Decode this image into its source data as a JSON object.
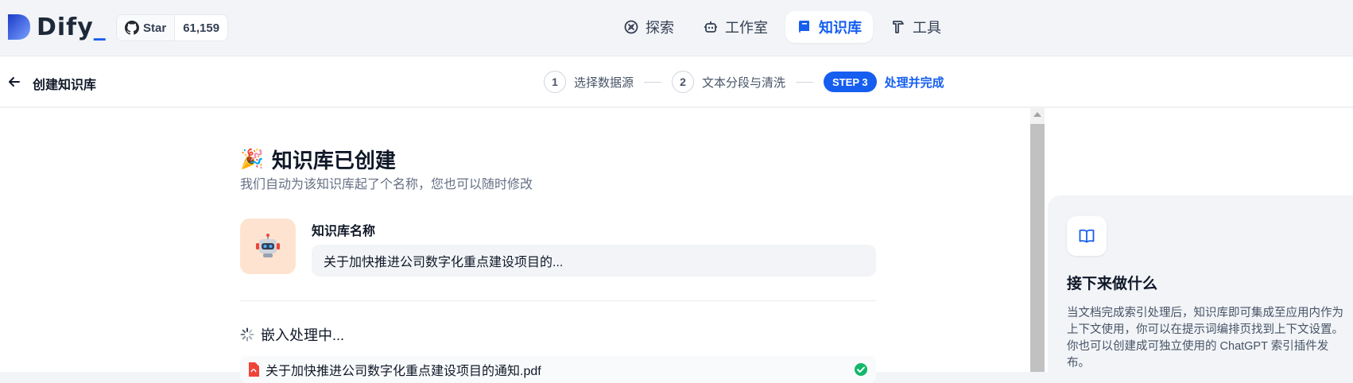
{
  "app": {
    "logo_text": "Dify",
    "github_star_label": "Star",
    "github_star_count": "61,159"
  },
  "nav": {
    "items": [
      {
        "label": "探索",
        "icon": "compass-icon"
      },
      {
        "label": "工作室",
        "icon": "robot-icon"
      },
      {
        "label": "知识库",
        "icon": "book-icon",
        "active": true
      },
      {
        "label": "工具",
        "icon": "hammer-icon"
      }
    ]
  },
  "stepbar": {
    "breadcrumb": "创建知识库",
    "steps": [
      {
        "num": "1",
        "label": "选择数据源"
      },
      {
        "num": "2",
        "label": "文本分段与清洗"
      },
      {
        "num": "STEP 3",
        "label": "处理并完成",
        "active": true
      }
    ]
  },
  "main": {
    "title_emoji": "🎉",
    "title": "知识库已创建",
    "subtitle": "我们自动为该知识库起了个名称，您也可以随时修改",
    "name_label": "知识库名称",
    "name_value": "关于加快推进公司数字化重点建设项目的...",
    "embed_status": "嵌入处理中...",
    "file_name": "关于加快推进公司数字化重点建设项目的通知.pdf"
  },
  "side": {
    "title": "接下来做什么",
    "text": "当文档完成索引处理后，知识库即可集成至应用内作为上下文使用，你可以在提示词编排页找到上下文设置。你也可以创建成可独立使用的 ChatGPT 索引插件发布。"
  },
  "colors": {
    "accent": "#155eef",
    "avatar_bg": "#fee4d0",
    "success": "#12b76a",
    "pdf": "#f04438"
  }
}
